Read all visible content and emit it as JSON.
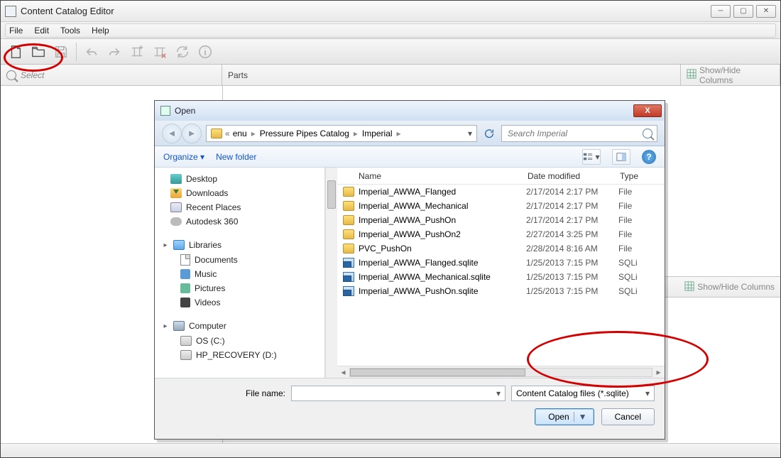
{
  "window": {
    "title": "Content Catalog Editor"
  },
  "menubar": [
    "File",
    "Edit",
    "Tools",
    "Help"
  ],
  "panels": {
    "left_placeholder": "Select",
    "mid_label": "Parts",
    "right_label": "Show/Hide Columns",
    "lower_right_label": "Show/Hide Columns"
  },
  "dialog": {
    "title": "Open",
    "breadcrumb": [
      "enu",
      "Pressure Pipes Catalog",
      "Imperial"
    ],
    "search_placeholder": "Search Imperial",
    "organize": "Organize",
    "newfolder": "New folder",
    "tree": {
      "favs": [
        {
          "label": "Desktop",
          "icon": "desktop"
        },
        {
          "label": "Downloads",
          "icon": "dl"
        },
        {
          "label": "Recent Places",
          "icon": "recent"
        },
        {
          "label": "Autodesk 360",
          "icon": "cloud"
        }
      ],
      "libraries_label": "Libraries",
      "libs": [
        {
          "label": "Documents",
          "icon": "doc"
        },
        {
          "label": "Music",
          "icon": "music"
        },
        {
          "label": "Pictures",
          "icon": "pic"
        },
        {
          "label": "Videos",
          "icon": "vid"
        }
      ],
      "computer_label": "Computer",
      "drives": [
        {
          "label": "OS (C:)",
          "icon": "os"
        },
        {
          "label": "HP_RECOVERY (D:)",
          "icon": "hp"
        }
      ]
    },
    "columns": {
      "name": "Name",
      "date": "Date modified",
      "type": "Type"
    },
    "files": [
      {
        "icon": "folder",
        "name": "Imperial_AWWA_Flanged",
        "date": "2/17/2014 2:17 PM",
        "type": "File folder"
      },
      {
        "icon": "folder",
        "name": "Imperial_AWWA_Mechanical",
        "date": "2/17/2014 2:17 PM",
        "type": "File folder"
      },
      {
        "icon": "folder",
        "name": "Imperial_AWWA_PushOn",
        "date": "2/17/2014 2:17 PM",
        "type": "File folder"
      },
      {
        "icon": "folder",
        "name": "Imperial_AWWA_PushOn2",
        "date": "2/27/2014 3:25 PM",
        "type": "File folder"
      },
      {
        "icon": "folder",
        "name": "PVC_PushOn",
        "date": "2/28/2014 8:16 AM",
        "type": "File folder"
      },
      {
        "icon": "sqlite",
        "name": "Imperial_AWWA_Flanged.sqlite",
        "date": "1/25/2013 7:15 PM",
        "type": "SQLite"
      },
      {
        "icon": "sqlite",
        "name": "Imperial_AWWA_Mechanical.sqlite",
        "date": "1/25/2013 7:15 PM",
        "type": "SQLite"
      },
      {
        "icon": "sqlite",
        "name": "Imperial_AWWA_PushOn.sqlite",
        "date": "1/25/2013 7:15 PM",
        "type": "SQLite"
      }
    ],
    "filename_label": "File name:",
    "filter": "Content Catalog files (*.sqlite)",
    "open": "Open",
    "cancel": "Cancel"
  }
}
